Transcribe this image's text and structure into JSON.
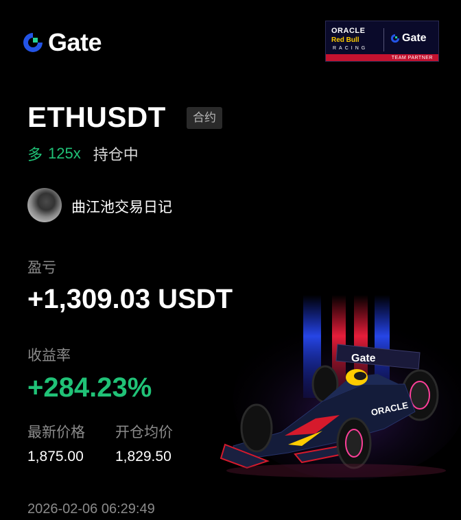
{
  "brand": {
    "logo_text": "Gate",
    "accent": "#1a73e8"
  },
  "partner_badge": {
    "line1": "ORACLE",
    "line2": "Red Bull",
    "line3": "RACING",
    "gate_text": "Gate",
    "footer": "TEAM PARTNER",
    "strip_color": "#c4122f"
  },
  "position": {
    "symbol": "ETHUSDT",
    "type_tag": "合约",
    "side": "多",
    "leverage": "125x",
    "status": "持仓中",
    "side_color": "#20c277"
  },
  "user": {
    "name": "曲江池交易日记"
  },
  "stats": {
    "pnl_label": "盈亏",
    "pnl_value": "+1,309.03 USDT",
    "roi_label": "收益率",
    "roi_value": "+284.23%",
    "latest_price_label": "最新价格",
    "latest_price": "1,875.00",
    "open_price_label": "开仓均价",
    "open_price": "1,829.50"
  },
  "timestamp": "2026-02-06 06:29:49",
  "car_art": {
    "sidepod_text": "ORACLE",
    "wing_text": "Gate"
  }
}
